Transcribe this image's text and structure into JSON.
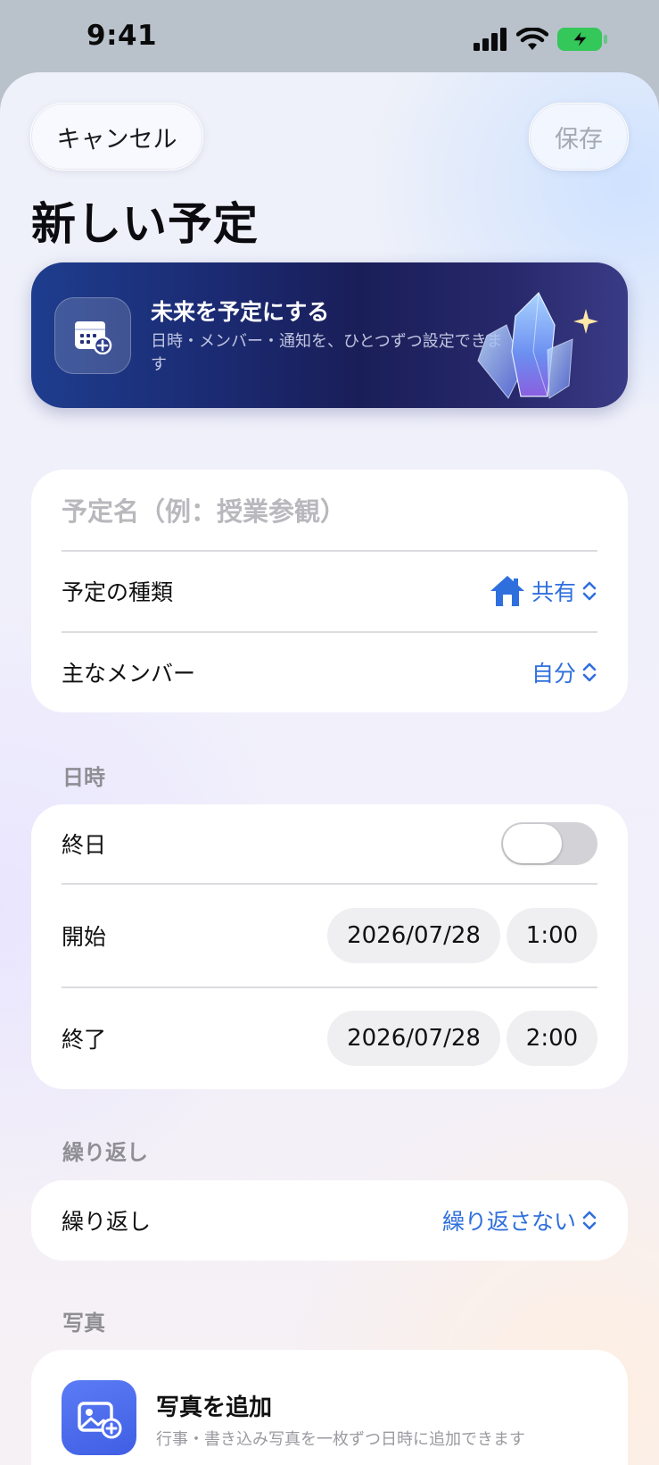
{
  "status_bar": {
    "time": "9:41"
  },
  "header": {
    "cancel_label": "キャンセル",
    "save_label": "保存",
    "title": "新しい予定"
  },
  "banner": {
    "title": "未来を予定にする",
    "subtitle": "日時・メンバー・通知を、ひとつずつ設定できます"
  },
  "details": {
    "name_placeholder": "予定名（例：授業参観）",
    "type_label": "予定の種類",
    "type_value": "共有",
    "member_label": "主なメンバー",
    "member_value": "自分"
  },
  "datetime": {
    "section_label": "日時",
    "all_day_label": "終日",
    "all_day_on": false,
    "start_label": "開始",
    "start_date": "2026/07/28",
    "start_time": "1:00",
    "end_label": "終了",
    "end_date": "2026/07/28",
    "end_time": "2:00"
  },
  "repeat": {
    "section_label": "繰り返し",
    "label": "繰り返し",
    "value": "繰り返さない"
  },
  "photo": {
    "section_label": "写真",
    "title": "写真を追加",
    "subtitle": "行事・書き込み写真を一枚ずつ日時に追加できます"
  },
  "colors": {
    "accent": "#2f6fdd",
    "banner_dark": "#1a1e58",
    "photo_icon": "#4a6af0"
  },
  "icons": [
    "signal-icon",
    "wifi-icon",
    "battery-charging-icon",
    "calendar-add-icon",
    "crystal-illustration",
    "sparkle-icon",
    "house-icon",
    "chevron-updown-icon",
    "photo-add-icon"
  ]
}
